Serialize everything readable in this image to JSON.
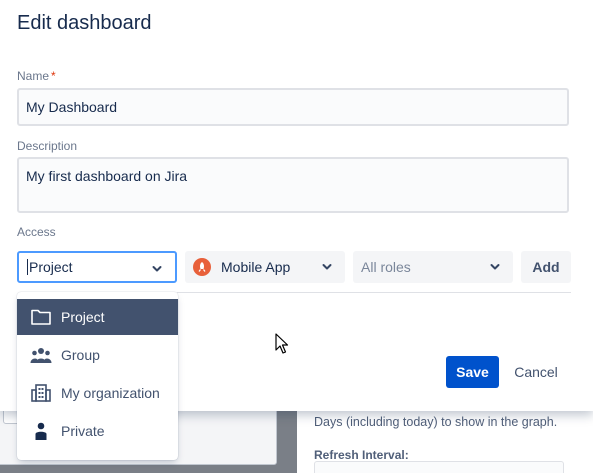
{
  "modal": {
    "title": "Edit dashboard"
  },
  "name_field": {
    "label": "Name",
    "required_mark": "*",
    "value": "My Dashboard"
  },
  "description_field": {
    "label": "Description",
    "value": "My first dashboard on Jira"
  },
  "access": {
    "label": "Access",
    "type_select": {
      "value": "Project"
    },
    "project_select": {
      "value": "Mobile App",
      "icon": "mobile-app-project-icon",
      "icon_color": "#E8603A"
    },
    "roles_select": {
      "placeholder": "All roles"
    },
    "add_label": "Add",
    "menu_items": [
      {
        "label": "Project",
        "icon": "folder-icon",
        "selected": true
      },
      {
        "label": "Group",
        "icon": "group-icon",
        "selected": false
      },
      {
        "label": "My organization",
        "icon": "organization-icon",
        "selected": false
      },
      {
        "label": "Private",
        "icon": "person-icon",
        "selected": false
      }
    ]
  },
  "actions": {
    "save_label": "Save",
    "cancel_label": "Cancel"
  },
  "background": {
    "hint": "Days (including today) to show in the graph.",
    "refresh_label": "Refresh Interval:"
  },
  "colors": {
    "primary": "#0052CC",
    "focus_border": "#4C9AFF",
    "menu_selected_bg": "#42526E",
    "required": "#DE350B",
    "text": "#172B4D"
  }
}
